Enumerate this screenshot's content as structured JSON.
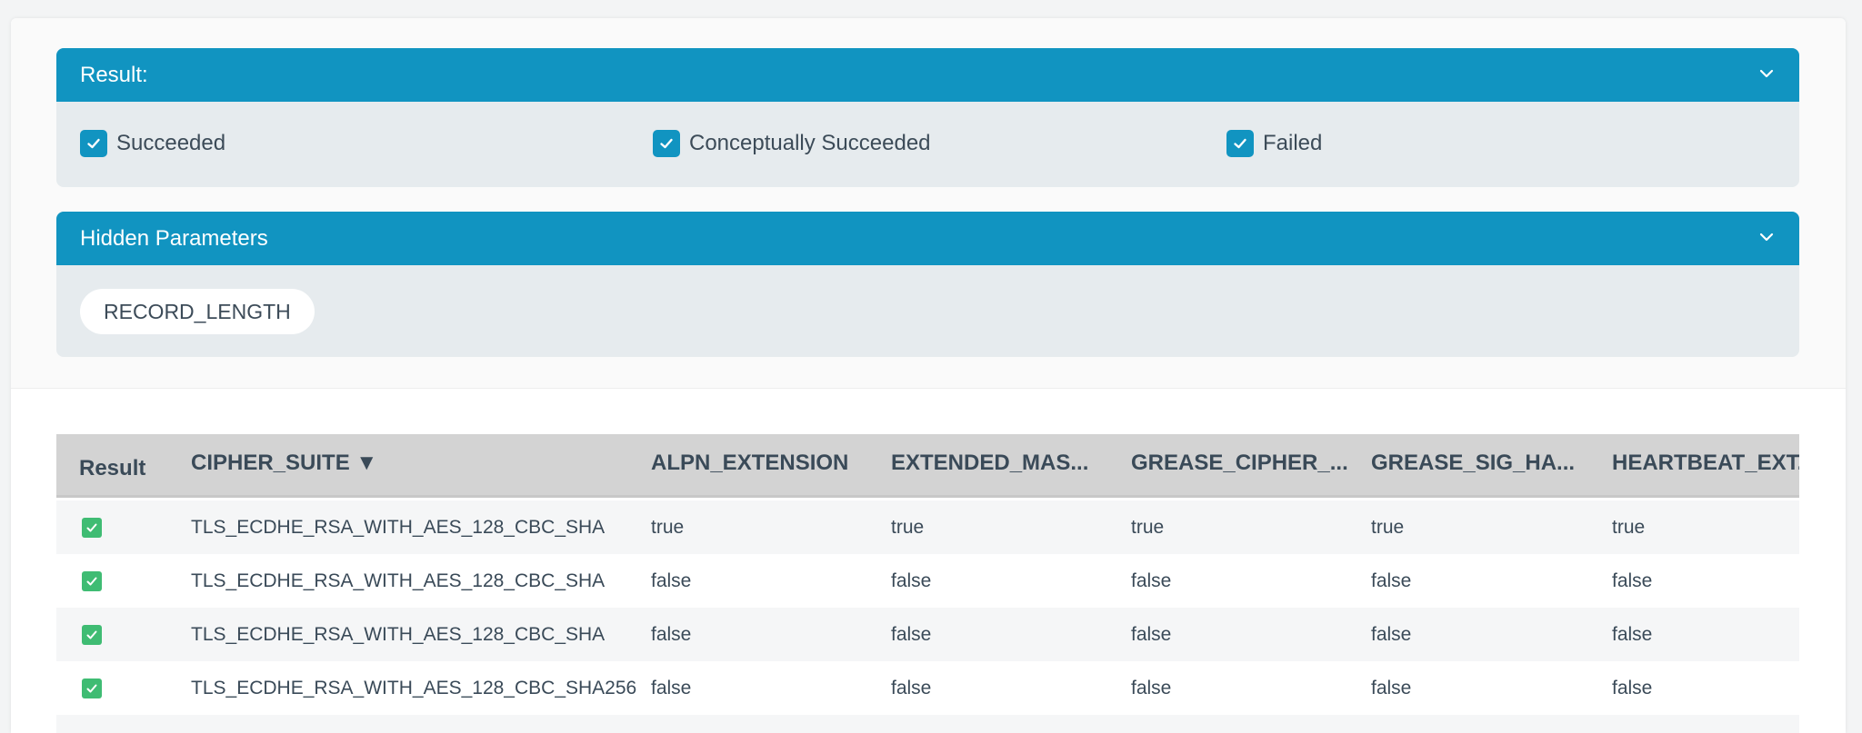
{
  "result_panel": {
    "title": "Result:",
    "options": [
      {
        "label": "Succeeded",
        "checked": true
      },
      {
        "label": "Conceptually Succeeded",
        "checked": true
      },
      {
        "label": "Failed",
        "checked": true
      }
    ]
  },
  "hidden_panel": {
    "title": "Hidden Parameters",
    "chips": [
      "RECORD_LENGTH"
    ]
  },
  "table": {
    "headers": [
      "Result",
      "CIPHER_SUITE ▼",
      "ALPN_EXTENSION",
      "EXTENDED_MAS...",
      "GREASE_CIPHER_...",
      "GREASE_SIG_HA...",
      "HEARTBEAT_EXT..."
    ],
    "rows": [
      {
        "cipher": "TLS_ECDHE_RSA_WITH_AES_128_CBC_SHA",
        "values": [
          "true",
          "true",
          "true",
          "true",
          "true"
        ]
      },
      {
        "cipher": "TLS_ECDHE_RSA_WITH_AES_128_CBC_SHA",
        "values": [
          "false",
          "false",
          "false",
          "false",
          "false"
        ]
      },
      {
        "cipher": "TLS_ECDHE_RSA_WITH_AES_128_CBC_SHA",
        "values": [
          "false",
          "false",
          "false",
          "false",
          "false"
        ]
      },
      {
        "cipher": "TLS_ECDHE_RSA_WITH_AES_128_CBC_SHA256",
        "values": [
          "false",
          "false",
          "false",
          "false",
          "false"
        ]
      }
    ]
  },
  "colors": {
    "accent": "#1194c1",
    "success": "#3fbc73",
    "panel_bg": "#e6ebee",
    "header_bg": "#d3d3d3"
  },
  "icons": {
    "panel_toggle": "chevron-down-icon",
    "checkbox": "checkmark-icon",
    "row_result": "success-check-icon"
  }
}
